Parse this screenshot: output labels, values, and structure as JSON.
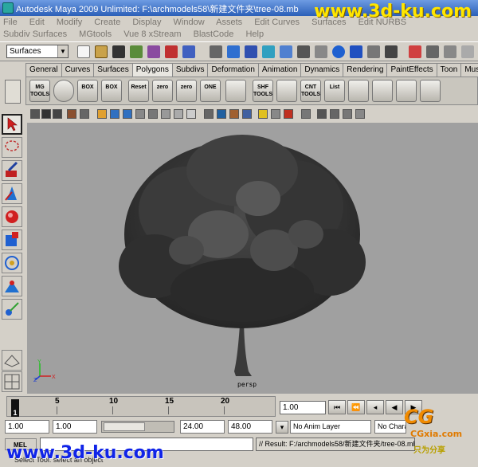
{
  "window": {
    "title": "Autodesk Maya 2009 Unlimited: F:\\archmodels58\\新建文件夹\\tree-08.mb",
    "watermark": "www.3d-ku.com"
  },
  "menus": {
    "row1": [
      "File",
      "Edit",
      "Modify",
      "Create",
      "Display",
      "Window",
      "Assets",
      "Edit Curves",
      "Surfaces",
      "Edit NURBS"
    ],
    "row2": [
      "Subdiv Surfaces",
      "MGtools",
      "Vue 8 xStream",
      "BlastCode",
      "Help"
    ]
  },
  "status_line": {
    "mode": "Surfaces"
  },
  "shelf": {
    "tabs": [
      "General",
      "Curves",
      "Surfaces",
      "Polygons",
      "Subdivs",
      "Deformation",
      "Animation",
      "Dynamics",
      "Rendering",
      "PaintEffects",
      "Toon",
      "Musc"
    ],
    "active_tab": "Polygons",
    "buttons": [
      "MG TOOLS",
      "",
      "BOX",
      "BOX",
      "Reset",
      "zero",
      "zero",
      "ONE",
      "",
      "SHF TOOLS",
      "",
      "CNT TOOLS",
      "List",
      "",
      "",
      "",
      ""
    ]
  },
  "viewport": {
    "camera_label": "persp",
    "axis": {
      "x": "X",
      "y": "Y",
      "z": "Z"
    }
  },
  "timeline": {
    "ticks": [
      "5",
      "10",
      "15",
      "20"
    ],
    "current_frame": "1",
    "current_frame_field": "1.00"
  },
  "range": {
    "start": "1.00",
    "playback_start": "1.00",
    "playback_end": "24.00",
    "end": "48.00",
    "anim_layer": "No Anim Layer",
    "character": "No Character"
  },
  "command_line": {
    "mel_label": "MEL",
    "result": "// Result: F:/archmodels58/新建文件夹/tree-08.mb",
    "help": "Select Tool: select an object"
  },
  "logo": {
    "cg": "CG",
    "site": "CGxia.com",
    "tag": "只为分享",
    "bottom_watermark": "www.3d-ku.com"
  }
}
